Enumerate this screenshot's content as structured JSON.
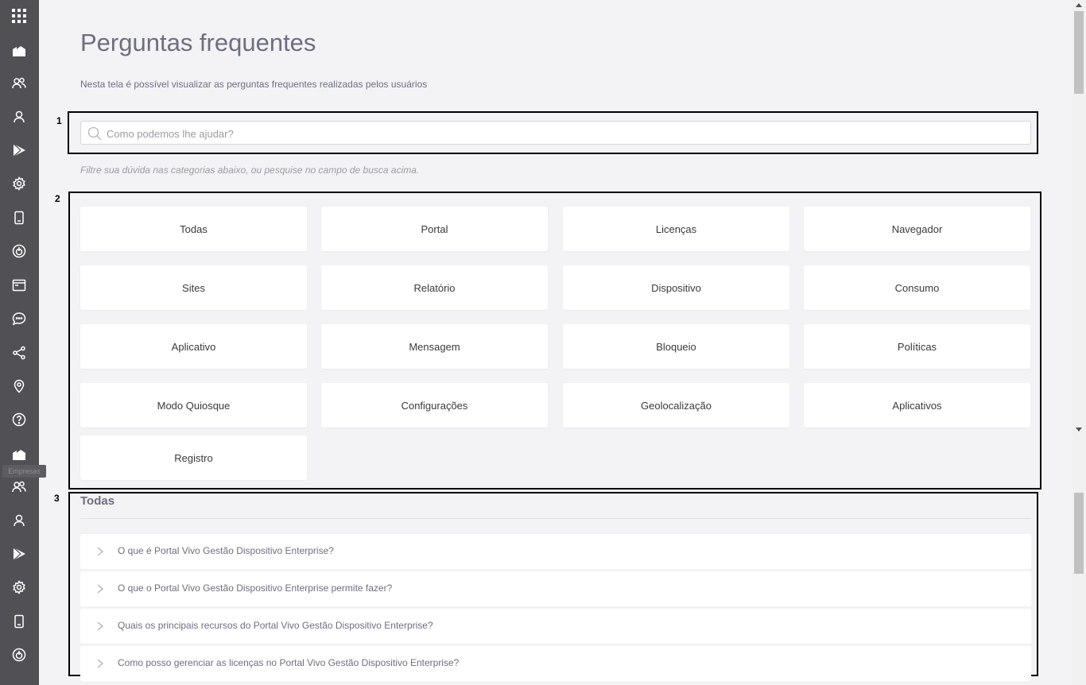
{
  "page": {
    "title": "Perguntas frequentes",
    "subtitle": "Nesta tela é possível visualizar as perguntas frequentes realizadas pelos usuários",
    "hint": "Filtre sua dúvida nas categorias abaixo, ou pesquise no campo de busca acima."
  },
  "markers": [
    "1",
    "2",
    "3"
  ],
  "sidebar": {
    "tooltip": "Empresas",
    "icons": [
      "apps-grid-icon",
      "company-icon",
      "users-icon",
      "user-icon",
      "play-store-icon",
      "settings-gear-icon",
      "device-icon",
      "power-target-icon",
      "browser-window-icon",
      "chat-icon",
      "share-icon",
      "location-pin-icon",
      "help-icon",
      "company-icon",
      "users-icon",
      "user-icon",
      "play-store-icon",
      "settings-gear-icon",
      "device-icon",
      "power-target-icon"
    ]
  },
  "search": {
    "placeholder": "Como podemos lhe ajudar?",
    "value": ""
  },
  "categories": [
    "Todas",
    "Portal",
    "Licenças",
    "Navegador",
    "Sites",
    "Relatório",
    "Dispositivo",
    "Consumo",
    "Aplicativo",
    "Mensagem",
    "Bloqueio",
    "Políticas",
    "Modo Quiosque",
    "Configurações",
    "Geolocalização",
    "Aplicativos",
    "Registro"
  ],
  "faq": {
    "section_title": "Todas",
    "items": [
      "O que é Portal Vivo Gestão Dispositivo Enterprise?",
      "O que o Portal Vivo Gestão Dispositivo Enterprise permite fazer?",
      "Quais os principais recursos do Portal Vivo Gestão Dispositivo Enterprise?",
      "Como posso gerenciar as licenças no Portal Vivo Gestão Dispositivo Enterprise?"
    ]
  },
  "colors": {
    "sidebar_bg": "#505055",
    "page_bg": "#f3f3f6",
    "title_text": "#6d6f80",
    "card_bg": "#ffffff"
  }
}
